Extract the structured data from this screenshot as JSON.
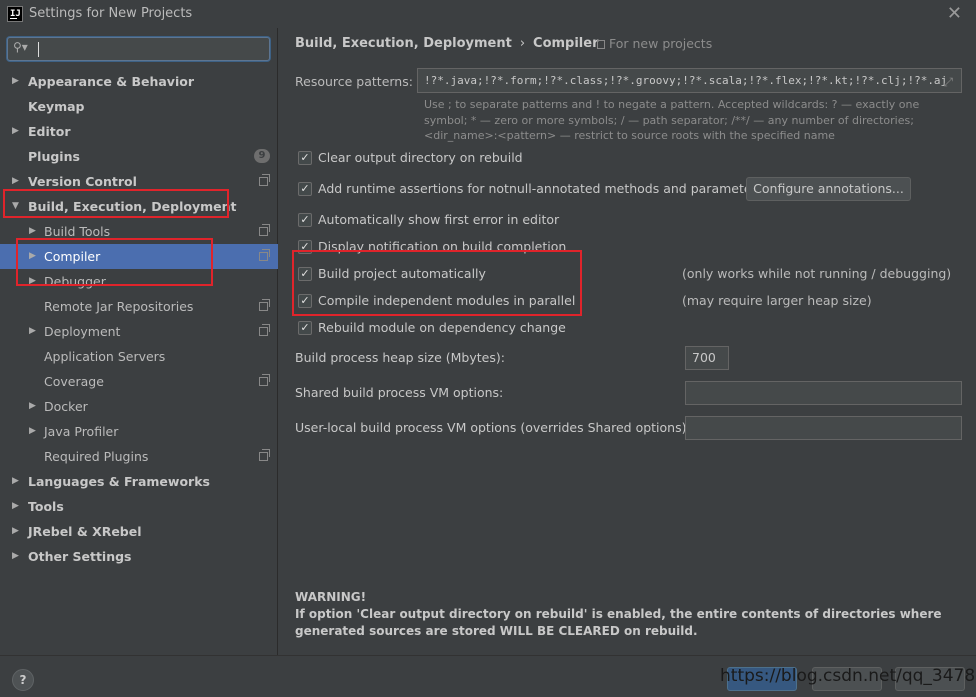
{
  "window": {
    "app_icon_text": "IJ",
    "title": "Settings for New Projects",
    "close_glyph": "✕"
  },
  "search": {
    "icon": "search-icon",
    "placeholder": ""
  },
  "sidebar": {
    "items": [
      {
        "label": "Appearance & Behavior",
        "level": 0,
        "arrow": "▶",
        "selected": false
      },
      {
        "label": "Keymap",
        "level": 0,
        "arrow": "",
        "selected": false
      },
      {
        "label": "Editor",
        "level": 0,
        "arrow": "▶",
        "selected": false
      },
      {
        "label": "Plugins",
        "level": 0,
        "arrow": "",
        "selected": false,
        "badge": "9"
      },
      {
        "label": "Version Control",
        "level": 0,
        "arrow": "▶",
        "selected": false,
        "copy_icon": true
      },
      {
        "label": "Build, Execution, Deployment",
        "level": 0,
        "arrow": "▼",
        "selected": false
      },
      {
        "label": "Build Tools",
        "level": 1,
        "arrow": "▶",
        "selected": false,
        "copy_icon": true
      },
      {
        "label": "Compiler",
        "level": 1,
        "arrow": "▶",
        "selected": true,
        "copy_icon": true
      },
      {
        "label": "Debugger",
        "level": 1,
        "arrow": "▶",
        "selected": false
      },
      {
        "label": "Remote Jar Repositories",
        "level": 1,
        "arrow": "",
        "selected": false,
        "copy_icon": true
      },
      {
        "label": "Deployment",
        "level": 1,
        "arrow": "▶",
        "selected": false,
        "copy_icon": true
      },
      {
        "label": "Application Servers",
        "level": 1,
        "arrow": "",
        "selected": false
      },
      {
        "label": "Coverage",
        "level": 1,
        "arrow": "",
        "selected": false,
        "copy_icon": true
      },
      {
        "label": "Docker",
        "level": 1,
        "arrow": "▶",
        "selected": false
      },
      {
        "label": "Java Profiler",
        "level": 1,
        "arrow": "▶",
        "selected": false
      },
      {
        "label": "Required Plugins",
        "level": 1,
        "arrow": "",
        "selected": false,
        "copy_icon": true
      },
      {
        "label": "Languages & Frameworks",
        "level": 0,
        "arrow": "▶",
        "selected": false
      },
      {
        "label": "Tools",
        "level": 0,
        "arrow": "▶",
        "selected": false
      },
      {
        "label": "JRebel & XRebel",
        "level": 0,
        "arrow": "▶",
        "selected": false
      },
      {
        "label": "Other Settings",
        "level": 0,
        "arrow": "▶",
        "selected": false
      }
    ]
  },
  "breadcrumb": {
    "parent": "Build, Execution, Deployment",
    "separator": "›",
    "current": "Compiler",
    "scope": "For new projects"
  },
  "resource_patterns": {
    "label": "Resource patterns:",
    "value": "!?*.java;!?*.form;!?*.class;!?*.groovy;!?*.scala;!?*.flex;!?*.kt;!?*.clj;!?*.aj",
    "hint": "Use ; to separate patterns and ! to negate a pattern. Accepted wildcards: ? — exactly one symbol; * — zero or more symbols; / — path separator; /**/ — any number of directories; <dir_name>:<pattern> — restrict to source roots with the specified name"
  },
  "options": {
    "clear_output": {
      "label": "Clear output directory on rebuild",
      "checked": true
    },
    "runtime_assertions": {
      "label": "Add runtime assertions for notnull-annotated methods and parameters",
      "checked": true
    },
    "configure_annotations": "Configure annotations...",
    "show_first_error": {
      "label": "Automatically show first error in editor",
      "checked": true
    },
    "display_notification": {
      "label": "Display notification on build completion",
      "checked": true
    },
    "build_automatically": {
      "label": "Build project automatically",
      "checked": true,
      "note": "(only works while not running / debugging)"
    },
    "compile_parallel": {
      "label": "Compile independent modules in parallel",
      "checked": true,
      "note": "(may require larger heap size)"
    },
    "rebuild_on_dependency": {
      "label": "Rebuild module on dependency change",
      "checked": true
    }
  },
  "fields": {
    "heap_label": "Build process heap size (Mbytes):",
    "heap_value": "700",
    "shared_vm_label": "Shared build process VM options:",
    "shared_vm_value": "",
    "user_vm_label": "User-local build process VM options (overrides Shared options):",
    "user_vm_value": ""
  },
  "warning": {
    "title": "WARNING!",
    "body": "If option 'Clear output directory on rebuild' is enabled, the entire contents of directories where generated sources are stored WILL BE CLEARED on rebuild."
  },
  "footer": {
    "help": "?",
    "ok": "OK",
    "cancel": "Cancel",
    "apply": "Apply",
    "watermark": "https://blog.csdn.net/qq_34789577"
  },
  "check_glyph": "✓",
  "annotation_color": "#e0242b"
}
